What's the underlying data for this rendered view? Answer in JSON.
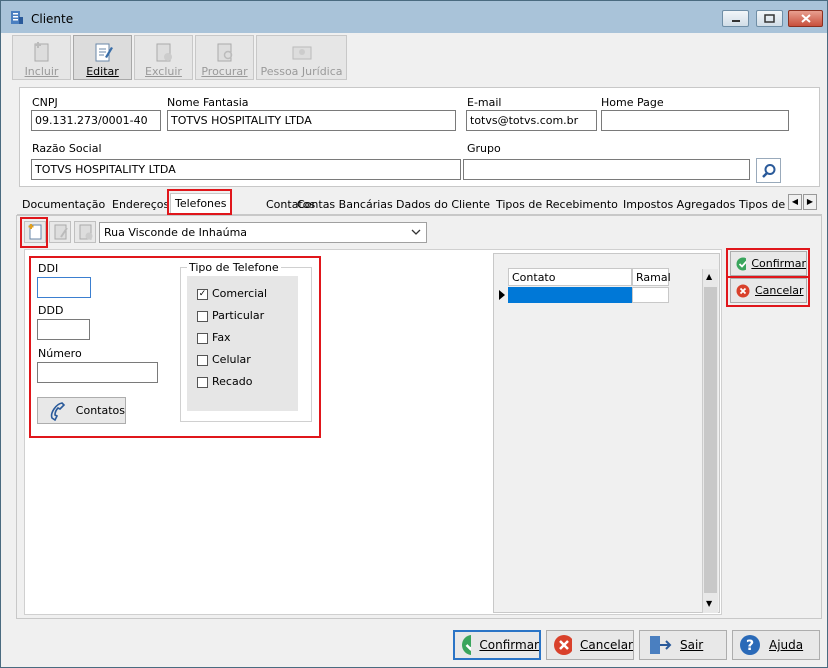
{
  "window": {
    "title": "Cliente"
  },
  "toolbar": {
    "incluir": "Incluir",
    "editar": "Editar",
    "excluir": "Excluir",
    "procurar": "Procurar",
    "pessoa_juridica": "Pessoa Jurídica"
  },
  "header": {
    "cnpj_label": "CNPJ",
    "cnpj_value": "09.131.273/0001-40",
    "nome_fantasia_label": "Nome Fantasia",
    "nome_fantasia_value": "TOTVS HOSPITALITY LTDA",
    "email_label": "E-mail",
    "email_value": "totvs@totvs.com.br",
    "homepage_label": "Home Page",
    "homepage_value": "",
    "razao_social_label": "Razão Social",
    "razao_social_value": "TOTVS HOSPITALITY LTDA",
    "grupo_label": "Grupo",
    "grupo_value": ""
  },
  "tabs": [
    "Documentação",
    "Endereços",
    "Telefones",
    "Contatos",
    "Contas Bancárias",
    "Dados do Cliente",
    "Tipos de Recebimento",
    "Impostos Agregados",
    "Tipos de"
  ],
  "address_combo": "Rua Visconde de Inhaúma",
  "phone_form": {
    "ddi_label": "DDI",
    "ddd_label": "DDD",
    "numero_label": "Número",
    "contatos_button": "Contatos",
    "tipo_legend": "Tipo de Telefone",
    "tipos": [
      {
        "label": "Comercial",
        "checked": true
      },
      {
        "label": "Particular",
        "checked": false
      },
      {
        "label": "Fax",
        "checked": false
      },
      {
        "label": "Celular",
        "checked": false
      },
      {
        "label": "Recado",
        "checked": false
      }
    ]
  },
  "grid": {
    "col_contato": "Contato",
    "col_ramal": "Ramal"
  },
  "side_buttons": {
    "confirmar": "Confirmar",
    "cancelar": "Cancelar"
  },
  "bottom": {
    "confirmar": "Confirmar",
    "cancelar": "Cancelar",
    "sair": "Sair",
    "ajuda": "Ajuda"
  },
  "colors": {
    "highlight": "#e0161b",
    "selection": "#0078d7",
    "confirm_green": "#3aa55c",
    "cancel_red": "#d9412b"
  }
}
